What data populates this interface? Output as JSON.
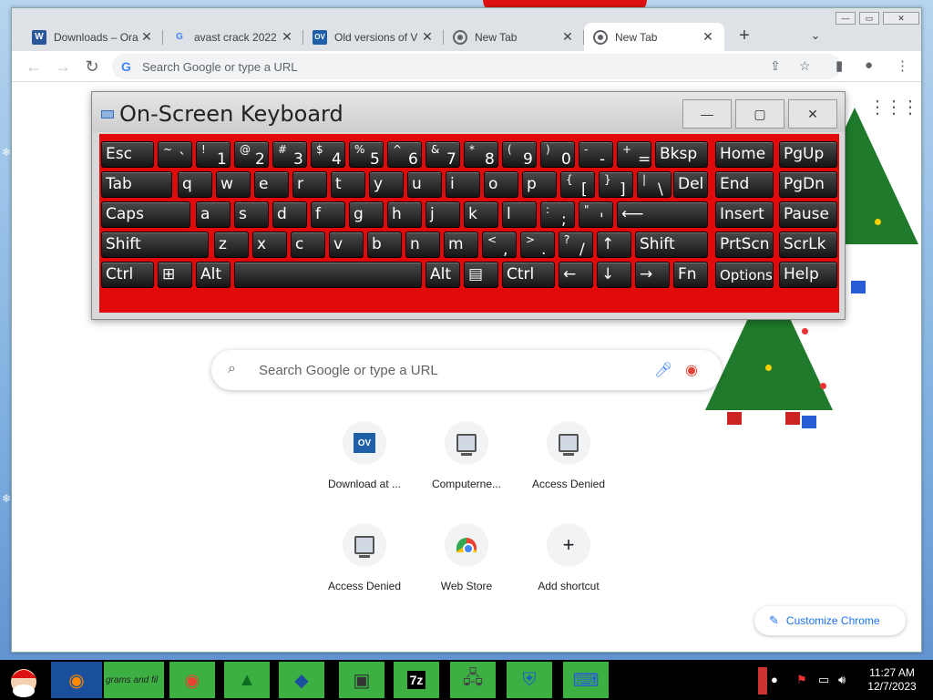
{
  "browser": {
    "tabs": [
      {
        "title": "Downloads – Ora",
        "favicon": "word-doc-icon",
        "active": false
      },
      {
        "title": "avast crack 2022",
        "favicon": "google-icon",
        "active": false
      },
      {
        "title": "Old versions of V",
        "favicon": "ov-icon",
        "active": false
      },
      {
        "title": "New Tab",
        "favicon": "chrome-icon",
        "active": false
      },
      {
        "title": "New Tab",
        "favicon": "chrome-icon",
        "active": true
      }
    ],
    "new_tab_symbol": "+",
    "tab_close_symbol": "✕",
    "omnibox_placeholder": "Search Google or type a URL",
    "window_controls": {
      "minimize": "—",
      "maximize": "▭",
      "close": "✕"
    }
  },
  "newtab": {
    "search_placeholder": "Search Google or type a URL",
    "shortcuts": [
      {
        "label": "Download at ...",
        "icon": "ov-logo-icon",
        "logo_text": "OV"
      },
      {
        "label": "Computerne...",
        "icon": "computer-icon"
      },
      {
        "label": "Access Denied",
        "icon": "computer-icon"
      },
      {
        "label": "Access Denied",
        "icon": "computer-icon"
      },
      {
        "label": "Web Store",
        "icon": "web-store-icon"
      },
      {
        "label": "Add shortcut",
        "icon": "plus-icon"
      }
    ],
    "customize_label": "Customize Chrome"
  },
  "osk": {
    "title": "On-Screen Keyboard",
    "rows": [
      [
        {
          "main": "Esc"
        },
        {
          "sh": "~",
          "lo": "`"
        },
        {
          "sh": "!",
          "lo": "1"
        },
        {
          "sh": "@",
          "lo": "2"
        },
        {
          "sh": "#",
          "lo": "3"
        },
        {
          "sh": "$",
          "lo": "4"
        },
        {
          "sh": "%",
          "lo": "5"
        },
        {
          "sh": "^",
          "lo": "6"
        },
        {
          "sh": "&",
          "lo": "7"
        },
        {
          "sh": "*",
          "lo": "8"
        },
        {
          "sh": "(",
          "lo": "9"
        },
        {
          "sh": ")",
          "lo": "0"
        },
        {
          "sh": "-",
          "lo": "-"
        },
        {
          "sh": "+",
          "lo": "="
        },
        {
          "main": "Bksp"
        },
        {
          "main": "Home"
        },
        {
          "main": "PgUp"
        }
      ],
      [
        {
          "main": "Tab"
        },
        {
          "main": "q"
        },
        {
          "main": "w"
        },
        {
          "main": "e"
        },
        {
          "main": "r"
        },
        {
          "main": "t"
        },
        {
          "main": "y"
        },
        {
          "main": "u"
        },
        {
          "main": "i"
        },
        {
          "main": "o"
        },
        {
          "main": "p"
        },
        {
          "sh": "{",
          "lo": "["
        },
        {
          "sh": "}",
          "lo": "]"
        },
        {
          "sh": "|",
          "lo": "\\"
        },
        {
          "main": "Del"
        },
        {
          "main": "End"
        },
        {
          "main": "PgDn"
        }
      ],
      [
        {
          "main": "Caps"
        },
        {
          "main": "a"
        },
        {
          "main": "s"
        },
        {
          "main": "d"
        },
        {
          "main": "f"
        },
        {
          "main": "g"
        },
        {
          "main": "h"
        },
        {
          "main": "j"
        },
        {
          "main": "k"
        },
        {
          "main": "l"
        },
        {
          "sh": ":",
          "lo": ";"
        },
        {
          "sh": "\"",
          "lo": "'"
        },
        {
          "main": "⟵"
        },
        {
          "main": "Insert"
        },
        {
          "main": "Pause"
        }
      ],
      [
        {
          "main": "Shift"
        },
        {
          "main": "z"
        },
        {
          "main": "x"
        },
        {
          "main": "c"
        },
        {
          "main": "v"
        },
        {
          "main": "b"
        },
        {
          "main": "n"
        },
        {
          "main": "m"
        },
        {
          "sh": "<",
          "lo": ","
        },
        {
          "sh": ">",
          "lo": "."
        },
        {
          "sh": "?",
          "lo": "/"
        },
        {
          "main": "↑"
        },
        {
          "main": "Shift"
        },
        {
          "main": "PrtScn"
        },
        {
          "main": "ScrLk"
        }
      ],
      [
        {
          "main": "Ctrl"
        },
        {
          "main": "⊞"
        },
        {
          "main": "Alt"
        },
        {
          "main": ""
        },
        {
          "main": "Alt"
        },
        {
          "main": "▤"
        },
        {
          "main": "Ctrl"
        },
        {
          "main": "←"
        },
        {
          "main": "↓"
        },
        {
          "main": "→"
        },
        {
          "main": "Fn"
        },
        {
          "main": "Options"
        },
        {
          "main": "Help"
        }
      ]
    ]
  },
  "taskbar": {
    "partial_label": "grams and fil",
    "time": "11:27 AM",
    "date": "12/7/2023"
  }
}
